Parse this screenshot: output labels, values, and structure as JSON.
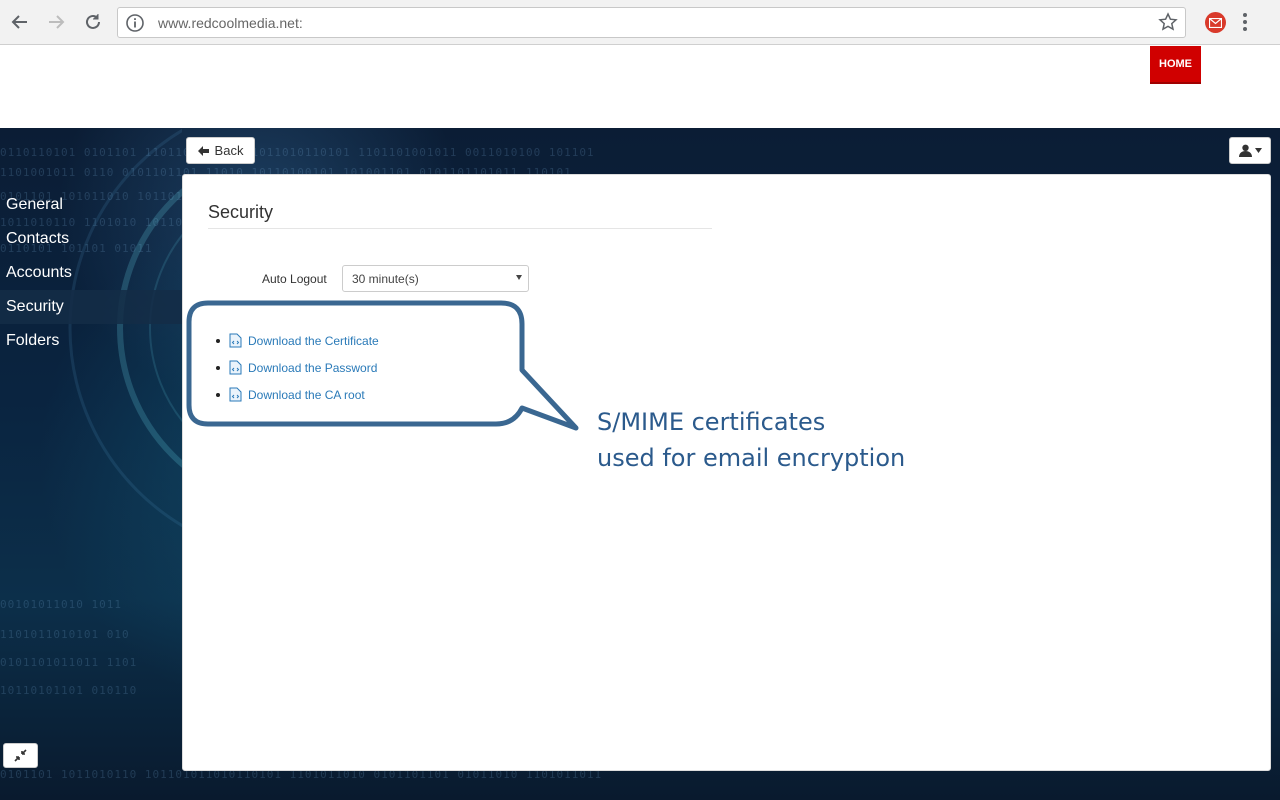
{
  "browser": {
    "url_main": "www.redcoolmedia.net",
    "url_suffix": ":"
  },
  "site": {
    "home_label": "HOME"
  },
  "toolbar": {
    "back_label": "Back"
  },
  "sidebar": {
    "items": [
      {
        "label": "General"
      },
      {
        "label": "Contacts"
      },
      {
        "label": "Accounts"
      },
      {
        "label": "Security",
        "active": true
      },
      {
        "label": "Folders"
      }
    ]
  },
  "main": {
    "title": "Security",
    "auto_logout_label": "Auto Logout",
    "auto_logout_value": "30 minute(s)",
    "downloads": [
      {
        "label": "Download the Certificate"
      },
      {
        "label": "Download the Password"
      },
      {
        "label": "Download the CA root"
      }
    ]
  },
  "annotation": {
    "line1": "S/MIME certificates",
    "line2": "used for email encryption"
  },
  "colors": {
    "home_red": "#d00000",
    "link_blue": "#2a7ab8",
    "callout_blue": "#2b5a8c",
    "app_dark": "#0b1d35"
  }
}
